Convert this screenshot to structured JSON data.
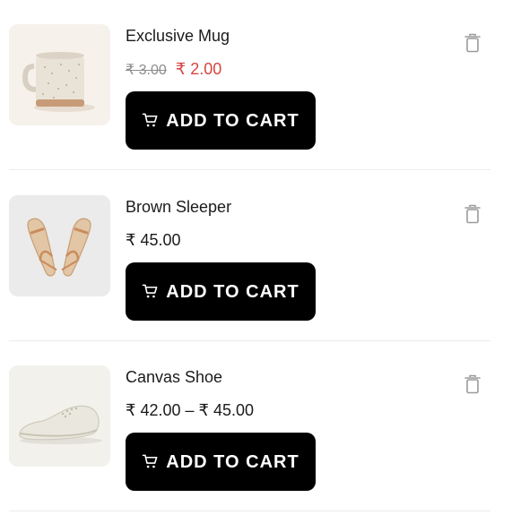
{
  "currency_symbol": "₹",
  "cart_button_label": "ADD TO CART",
  "colors": {
    "button_bg": "#000000",
    "sale_price": "#d64541",
    "old_price": "#8d8d8d",
    "trash_icon": "#9b9b9b"
  },
  "items": [
    {
      "name": "Exclusive Mug",
      "old_price": "₹ 3.00",
      "price": "₹ 2.00",
      "image_icon": "mug-icon"
    },
    {
      "name": "Brown Sleeper",
      "price": "₹ 45.00",
      "image_icon": "sandals-icon"
    },
    {
      "name": "Canvas Shoe",
      "price": "₹ 42.00 – ₹ 45.00",
      "image_icon": "shoe-icon"
    }
  ]
}
